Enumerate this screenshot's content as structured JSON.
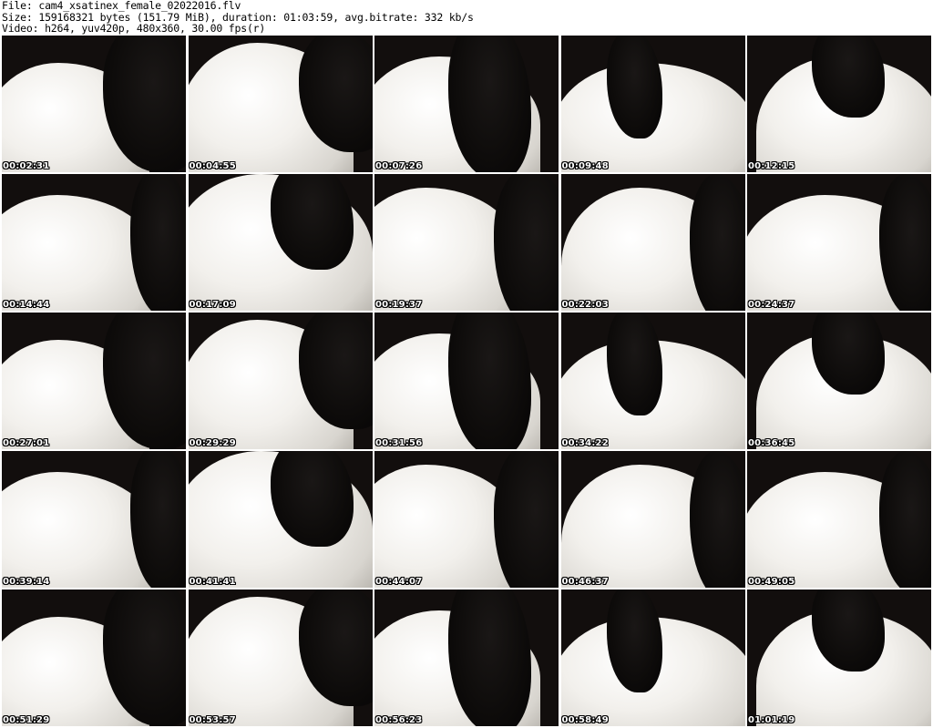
{
  "header": {
    "line1": "File: cam4_xsatinex_female_02022016.flv",
    "line2": "Size: 159168321 bytes (151.79 MiB), duration: 01:03:59, avg.bitrate: 332 kb/s",
    "line3": "Video: h264, yuv420p, 480x360, 30.00 fps(r)"
  },
  "thumbnails": [
    {
      "timecode": "00:02:31"
    },
    {
      "timecode": "00:04:55"
    },
    {
      "timecode": "00:07:26"
    },
    {
      "timecode": "00:09:48"
    },
    {
      "timecode": "00:12:15"
    },
    {
      "timecode": "00:14:44"
    },
    {
      "timecode": "00:17:09"
    },
    {
      "timecode": "00:19:37"
    },
    {
      "timecode": "00:22:03"
    },
    {
      "timecode": "00:24:37"
    },
    {
      "timecode": "00:27:01"
    },
    {
      "timecode": "00:29:29"
    },
    {
      "timecode": "00:31:56"
    },
    {
      "timecode": "00:34:22"
    },
    {
      "timecode": "00:36:45"
    },
    {
      "timecode": "00:39:14"
    },
    {
      "timecode": "00:41:41"
    },
    {
      "timecode": "00:44:07"
    },
    {
      "timecode": "00:46:37"
    },
    {
      "timecode": "00:49:05"
    },
    {
      "timecode": "00:51:29"
    },
    {
      "timecode": "00:53:57"
    },
    {
      "timecode": "00:56:23"
    },
    {
      "timecode": "00:58:49"
    },
    {
      "timecode": "01:01:19"
    }
  ]
}
